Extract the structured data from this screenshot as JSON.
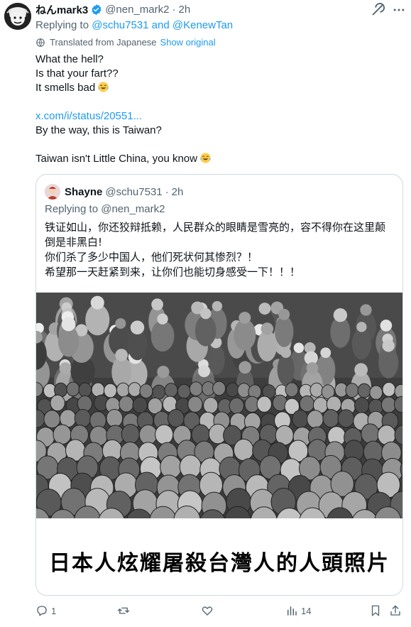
{
  "tweet": {
    "display_name": "ねんmark3",
    "handle": "@nen_mark2",
    "dot": "·",
    "time": "2h",
    "replying_prefix": "Replying to",
    "reply_user_1": "@schu7531",
    "reply_and": "and",
    "reply_user_2": "@KenewTan",
    "translated_label": "Translated from Japanese",
    "show_original": "Show original",
    "lines": {
      "l1": "What the hell?",
      "l2": "Is that your fart??",
      "l3": "It smells bad",
      "link": "x.com/i/status/20551...",
      "l5": "By the way, this is Taiwan?",
      "l6": "Taiwan isn't Little China, you know"
    },
    "emoji": "face-with-tears-of-joy-icon"
  },
  "quote": {
    "display_name": "Shayne",
    "handle": "@schu7531",
    "dot": "·",
    "time": "2h",
    "replying": "Replying to @nen_mark2",
    "text_lines": {
      "l1": "铁证如山，你还狡辩抵赖，人民群众的眼睛是雪亮的，容不得你在这里颠",
      "l2": "倒是非黑白!",
      "l3": "你们杀了多少中国人，他们死状何其惨烈？！",
      "l4": "希望那一天赶紧到来，让你们也能切身感受一下！！！"
    },
    "image_caption": "日本人炫耀屠殺台灣人的人頭照片"
  },
  "actions": {
    "reply_count": "1",
    "retweet_count": "",
    "like_count": "",
    "views_count": "14"
  },
  "colors": {
    "accent": "#1d9bf0",
    "secondary_text": "#536471",
    "primary_text": "#0f1419",
    "border": "#cfd9de"
  }
}
